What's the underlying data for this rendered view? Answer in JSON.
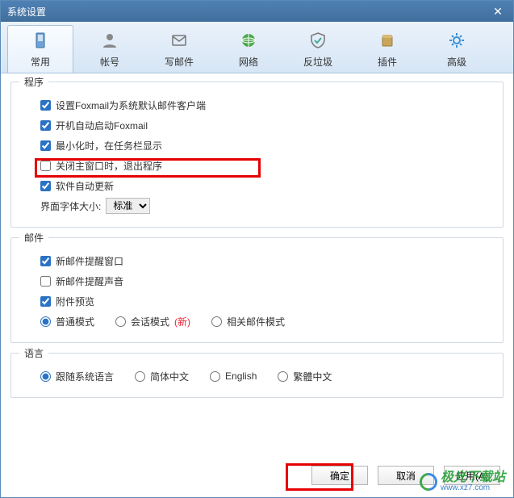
{
  "title": "系统设置",
  "tabs": [
    {
      "label": "常用",
      "icon": "common"
    },
    {
      "label": "帐号",
      "icon": "account"
    },
    {
      "label": "写邮件",
      "icon": "compose"
    },
    {
      "label": "网络",
      "icon": "network"
    },
    {
      "label": "反垃圾",
      "icon": "spam"
    },
    {
      "label": "插件",
      "icon": "plugin"
    },
    {
      "label": "高级",
      "icon": "advanced"
    }
  ],
  "program": {
    "title": "程序",
    "items": [
      {
        "label": "设置Foxmail为系统默认邮件客户端",
        "checked": true
      },
      {
        "label": "开机自动启动Foxmail",
        "checked": true
      },
      {
        "label": "最小化时，在任务栏显示",
        "checked": true
      },
      {
        "label": "关闭主窗口时，退出程序",
        "checked": false
      },
      {
        "label": "软件自动更新",
        "checked": true
      }
    ],
    "fontLabel": "界面字体大小:",
    "fontValue": "标准"
  },
  "mail": {
    "title": "邮件",
    "items": [
      {
        "label": "新邮件提醒窗口",
        "checked": true
      },
      {
        "label": "新邮件提醒声音",
        "checked": false
      },
      {
        "label": "附件预览",
        "checked": true
      }
    ],
    "modes": [
      {
        "label": "普通模式",
        "selected": true
      },
      {
        "label": "会话模式",
        "selected": false,
        "hint": "(新)"
      },
      {
        "label": "相关邮件模式",
        "selected": false
      }
    ]
  },
  "language": {
    "title": "语言",
    "options": [
      {
        "label": "跟随系统语言",
        "selected": true
      },
      {
        "label": "简体中文",
        "selected": false
      },
      {
        "label": "English",
        "selected": false
      },
      {
        "label": "繁體中文",
        "selected": false
      }
    ]
  },
  "buttons": {
    "ok": "确定",
    "cancel": "取消",
    "apply": "应用(A)"
  },
  "watermark": {
    "text": "极光下载站",
    "url": "www.xz7.com"
  }
}
